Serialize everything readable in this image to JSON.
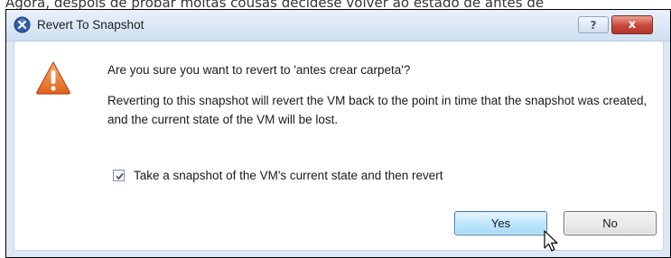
{
  "background_text": "Agora, despois de probar moitas cousas decidese volver ao estado de antes de",
  "dialog": {
    "title": "Revert To Snapshot",
    "help_label": "?",
    "close_label": "x",
    "question": "Are you sure you want to revert to 'antes crear carpeta'?",
    "explanation": "Reverting to this snapshot will revert the VM back to the point in time that the snapshot was created, and the current state of the VM will be lost.",
    "checkbox": {
      "label": "Take a snapshot of the VM's current state and then revert",
      "checked": true
    },
    "buttons": {
      "yes": "Yes",
      "no": "No"
    }
  },
  "icons": {
    "title": "vmware-app-icon",
    "warning": "warning-triangle-icon",
    "cursor": "mouse-pointer-icon"
  },
  "colors": {
    "accent": "#3c7fb1",
    "close": "#c9473a",
    "warning": "#e8742a"
  }
}
